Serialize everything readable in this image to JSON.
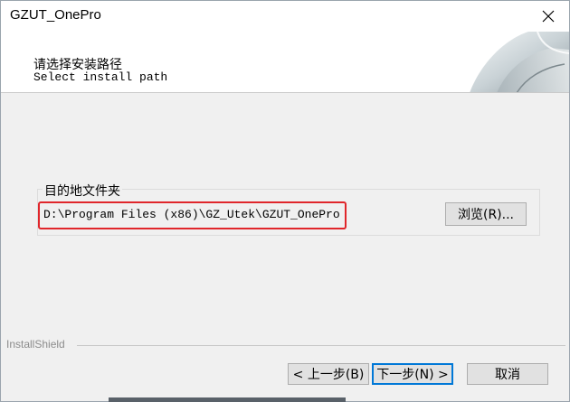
{
  "window": {
    "title": "GZUT_OnePro"
  },
  "header": {
    "title_cn": "请选择安装路径",
    "title_en": "Select install path"
  },
  "destination": {
    "group_label": "目的地文件夹",
    "path": "D:\\Program Files (x86)\\GZ_Utek\\GZUT_OnePro",
    "browse_label": "浏览(R)..."
  },
  "footer": {
    "brand": "InstallShield",
    "back_label": "< 上一步(B)",
    "next_label": "下一步(N) >",
    "cancel_label": "取消"
  },
  "icons": {
    "close": "close-icon"
  },
  "colors": {
    "highlight_border": "#e0262b",
    "default_button_border": "#0078d7"
  }
}
